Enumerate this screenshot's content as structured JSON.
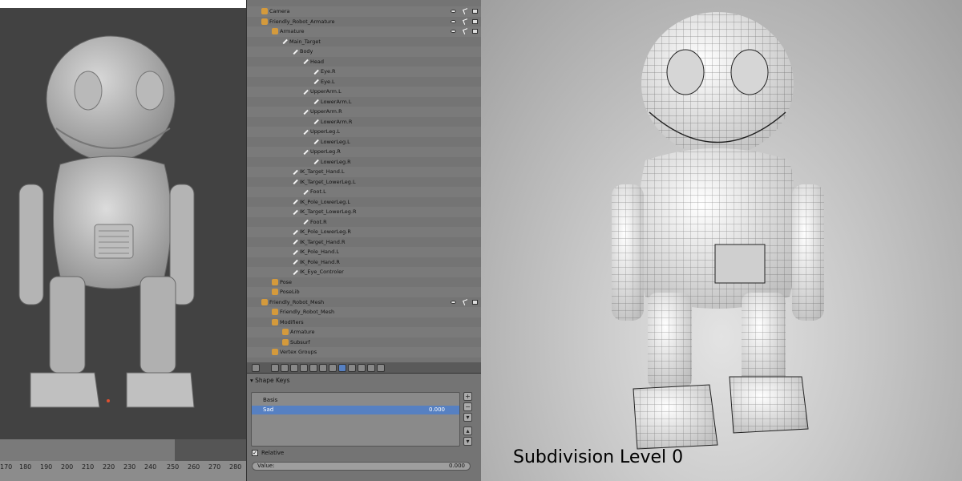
{
  "outliner": {
    "items": [
      {
        "label": "Camera",
        "depth": 0,
        "icon": "camera-icon"
      },
      {
        "label": "Friendly_Robot_Armature",
        "depth": 0,
        "icon": "armature-icon"
      },
      {
        "label": "Armature",
        "depth": 1,
        "icon": "armature-data-icon"
      },
      {
        "label": "Main_Target",
        "depth": 2,
        "icon": "bone-icon"
      },
      {
        "label": "Body",
        "depth": 3,
        "icon": "bone-icon"
      },
      {
        "label": "Head",
        "depth": 4,
        "icon": "bone-icon"
      },
      {
        "label": "Eye.R",
        "depth": 5,
        "icon": "bone-icon"
      },
      {
        "label": "Eye.L",
        "depth": 5,
        "icon": "bone-icon"
      },
      {
        "label": "UpperArm.L",
        "depth": 4,
        "icon": "bone-icon"
      },
      {
        "label": "LowerArm.L",
        "depth": 5,
        "icon": "bone-icon"
      },
      {
        "label": "UpperArm.R",
        "depth": 4,
        "icon": "bone-icon"
      },
      {
        "label": "LowerArm.R",
        "depth": 5,
        "icon": "bone-icon"
      },
      {
        "label": "UpperLeg.L",
        "depth": 4,
        "icon": "bone-icon"
      },
      {
        "label": "LowerLeg.L",
        "depth": 5,
        "icon": "bone-icon"
      },
      {
        "label": "UpperLeg.R",
        "depth": 4,
        "icon": "bone-icon"
      },
      {
        "label": "LowerLeg.R",
        "depth": 5,
        "icon": "bone-icon"
      },
      {
        "label": "IK_Target_Hand.L",
        "depth": 3,
        "icon": "bone-icon"
      },
      {
        "label": "IK_Target_LowerLeg.L",
        "depth": 3,
        "icon": "bone-icon"
      },
      {
        "label": "Foot.L",
        "depth": 4,
        "icon": "bone-icon"
      },
      {
        "label": "IK_Pole_LowerLeg.L",
        "depth": 3,
        "icon": "bone-icon"
      },
      {
        "label": "IK_Target_LowerLeg.R",
        "depth": 3,
        "icon": "bone-icon"
      },
      {
        "label": "Foot.R",
        "depth": 4,
        "icon": "bone-icon"
      },
      {
        "label": "IK_Pole_LowerLeg.R",
        "depth": 3,
        "icon": "bone-icon"
      },
      {
        "label": "IK_Target_Hand.R",
        "depth": 3,
        "icon": "bone-icon"
      },
      {
        "label": "IK_Pole_Hand.L",
        "depth": 3,
        "icon": "bone-icon"
      },
      {
        "label": "IK_Pole_Hand.R",
        "depth": 3,
        "icon": "bone-icon"
      },
      {
        "label": "IK_Eye_Controler",
        "depth": 3,
        "icon": "bone-icon"
      },
      {
        "label": "Pose",
        "depth": 1,
        "icon": "pose-icon"
      },
      {
        "label": "PoseLib",
        "depth": 1,
        "icon": "poselib-icon"
      },
      {
        "label": "Friendly_Robot_Mesh",
        "depth": 0,
        "icon": "mesh-object-icon"
      },
      {
        "label": "Friendly_Robot_Mesh",
        "depth": 1,
        "icon": "mesh-data-icon"
      },
      {
        "label": "Modifiers",
        "depth": 1,
        "icon": "wrench-icon"
      },
      {
        "label": "Armature",
        "depth": 2,
        "icon": "armature-modifier-icon"
      },
      {
        "label": "Subsurf",
        "depth": 2,
        "icon": "subsurf-icon"
      },
      {
        "label": "Vertex Groups",
        "depth": 1,
        "icon": "vertex-groups-icon"
      }
    ]
  },
  "properties": {
    "panel_title": "Shape Keys",
    "shape_keys": [
      {
        "name": "Basis",
        "value": ""
      },
      {
        "name": "Sad",
        "value": "0.000"
      }
    ],
    "relative_label": "Relative",
    "value_label": "Value:",
    "value": "0.000"
  },
  "timeline": {
    "ticks": [
      "170",
      "180",
      "190",
      "200",
      "210",
      "220",
      "230",
      "240",
      "250",
      "260",
      "270",
      "280"
    ]
  },
  "render": {
    "caption": "Subdivision Level 0"
  },
  "colors": {
    "selection": "#5680c2",
    "viewport_bg": "#424242",
    "panel_bg": "#747474"
  }
}
